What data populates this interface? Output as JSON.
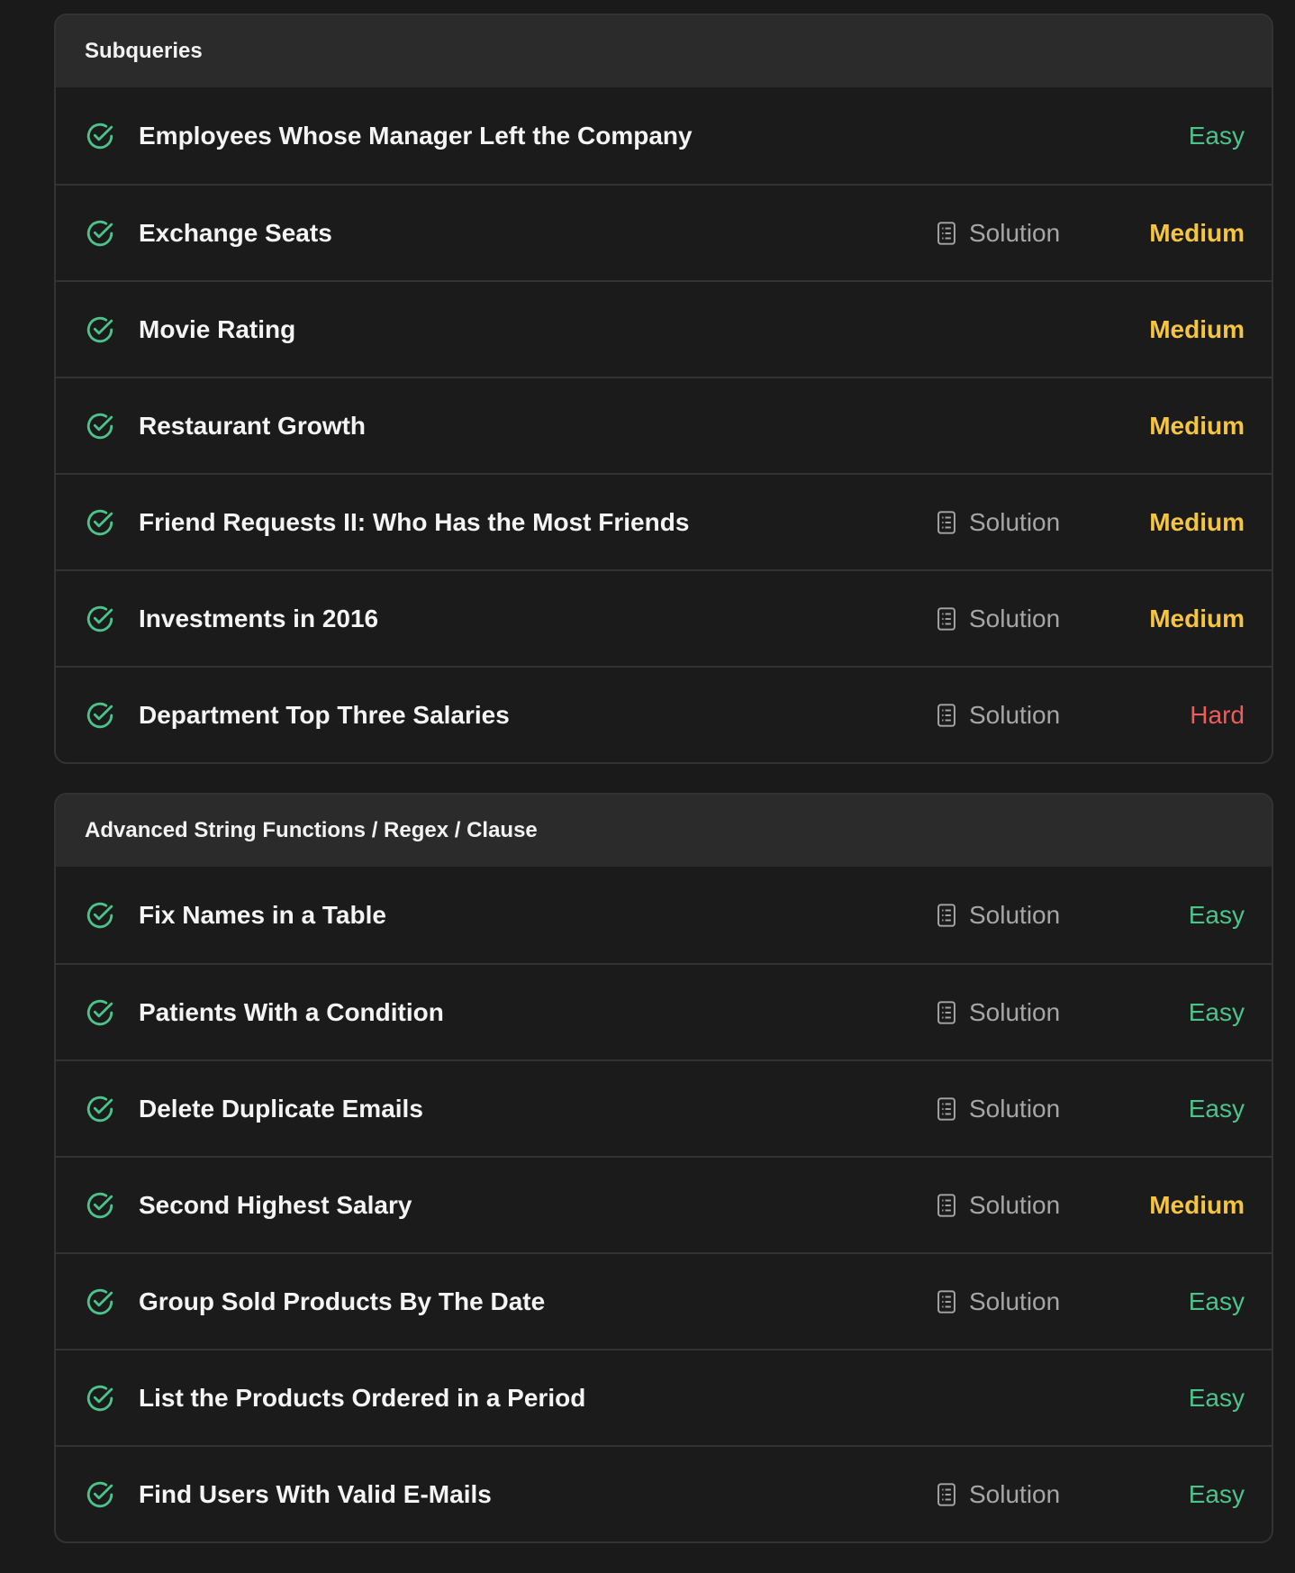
{
  "colors": {
    "easy": "#4cc38a",
    "medium": "#f5c542",
    "hard": "#ef5c5c",
    "check": "#4cc38a"
  },
  "sections": [
    {
      "title": "Subqueries",
      "items": [
        {
          "title": "Employees Whose Manager Left the Company",
          "solution": "",
          "difficulty": "Easy",
          "level": "easy"
        },
        {
          "title": "Exchange Seats",
          "solution": "Solution",
          "difficulty": "Medium",
          "level": "medium"
        },
        {
          "title": "Movie Rating",
          "solution": "",
          "difficulty": "Medium",
          "level": "medium"
        },
        {
          "title": "Restaurant Growth",
          "solution": "",
          "difficulty": "Medium",
          "level": "medium"
        },
        {
          "title": "Friend Requests II: Who Has the Most Friends",
          "solution": "Solution",
          "difficulty": "Medium",
          "level": "medium"
        },
        {
          "title": "Investments in 2016",
          "solution": "Solution",
          "difficulty": "Medium",
          "level": "medium"
        },
        {
          "title": "Department Top Three Salaries",
          "solution": "Solution",
          "difficulty": "Hard",
          "level": "hard"
        }
      ]
    },
    {
      "title": "Advanced String Functions / Regex / Clause",
      "items": [
        {
          "title": "Fix Names in a Table",
          "solution": "Solution",
          "difficulty": "Easy",
          "level": "easy"
        },
        {
          "title": "Patients With a Condition",
          "solution": "Solution",
          "difficulty": "Easy",
          "level": "easy"
        },
        {
          "title": "Delete Duplicate Emails",
          "solution": "Solution",
          "difficulty": "Easy",
          "level": "easy"
        },
        {
          "title": "Second Highest Salary",
          "solution": "Solution",
          "difficulty": "Medium",
          "level": "medium"
        },
        {
          "title": "Group Sold Products By The Date",
          "solution": "Solution",
          "difficulty": "Easy",
          "level": "easy"
        },
        {
          "title": "List the Products Ordered in a Period",
          "solution": "",
          "difficulty": "Easy",
          "level": "easy"
        },
        {
          "title": "Find Users With Valid E-Mails",
          "solution": "Solution",
          "difficulty": "Easy",
          "level": "easy"
        }
      ]
    }
  ]
}
